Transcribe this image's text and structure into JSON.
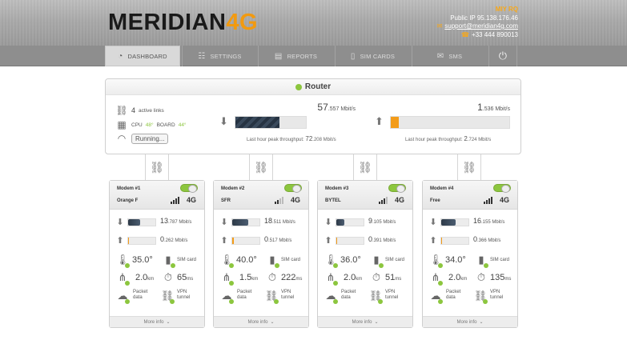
{
  "header": {
    "logo_part1": "MERIDIAN",
    "logo_part2": "4G",
    "site": "MIY RQ",
    "public_ip": "Public IP 95.138.176.46",
    "email": "support@meridian4g.com",
    "phone": "+33 444 890013",
    "email_icon": "mail-icon",
    "phone_icon": "phone-icon"
  },
  "nav": {
    "tabs": [
      {
        "label": "DASHBOARD",
        "icon": "gauge-icon",
        "active": true
      },
      {
        "label": "SETTINGS",
        "icon": "sliders-icon",
        "active": false
      },
      {
        "label": "REPORTS",
        "icon": "chart-icon",
        "active": false
      },
      {
        "label": "SIM CARDS",
        "icon": "simcard-icon",
        "active": false
      },
      {
        "label": "SMS",
        "icon": "envelope-icon",
        "active": false
      }
    ],
    "power_icon": "power-icon"
  },
  "router": {
    "title": "Router",
    "status_color": "#8cc63e",
    "links_count": "4",
    "links_label": "active links",
    "cpu_label": "CPU",
    "cpu_temp": "48°",
    "board_label": "BOARD",
    "board_temp": "44°",
    "running_label": "Running...",
    "download": {
      "value_int": "57",
      "value_dec": ".557 Mbit/s",
      "fill_percent": 62,
      "peak_label": "Last hour peak throughput:",
      "peak_int": "72",
      "peak_dec": ".208 Mbit/s"
    },
    "upload": {
      "value_int": "1",
      "value_dec": ".536 Mbit/s",
      "fill_percent": 7,
      "peak_label": "Last hour peak throughput:",
      "peak_int": "2",
      "peak_dec": ".724 Mbit/s"
    }
  },
  "modems": [
    {
      "name": "Modem #1",
      "operator": "Orange F",
      "network": "4G",
      "signal_bars": 4,
      "dl_int": "13",
      "dl_dec": ".787 Mbit/s",
      "dl_fill": 45,
      "ul_int": "0",
      "ul_dec": ".262 Mbit/s",
      "ul_fill": 3,
      "temp": "35.0°",
      "sim_label": "SIM card",
      "distance": "2.0",
      "distance_unit": "km",
      "latency": "65",
      "latency_unit": "ms",
      "packet_label1": "Packet",
      "packet_label2": "data",
      "vpn_label1": "VPN",
      "vpn_label2": "tunnel",
      "more_info": "More info"
    },
    {
      "name": "Modem #2",
      "operator": "SFR",
      "network": "4G",
      "signal_bars": 2,
      "dl_int": "18",
      "dl_dec": ".511 Mbit/s",
      "dl_fill": 58,
      "ul_int": "0",
      "ul_dec": ".517 Mbit/s",
      "ul_fill": 5,
      "temp": "40.0°",
      "sim_label": "SIM card",
      "distance": "1.5",
      "distance_unit": "km",
      "latency": "222",
      "latency_unit": "ms",
      "packet_label1": "Packet",
      "packet_label2": "data",
      "vpn_label1": "VPN",
      "vpn_label2": "tunnel",
      "more_info": "More info"
    },
    {
      "name": "Modem #3",
      "operator": "BYTEL",
      "network": "4G",
      "signal_bars": 3,
      "dl_int": "9",
      "dl_dec": ".105 Mbit/s",
      "dl_fill": 28,
      "ul_int": "0",
      "ul_dec": ".391 Mbit/s",
      "ul_fill": 4,
      "temp": "36.0°",
      "sim_label": "SIM card",
      "distance": "2.0",
      "distance_unit": "km",
      "latency": "51",
      "latency_unit": "ms",
      "packet_label1": "Packet",
      "packet_label2": "data",
      "vpn_label1": "VPN",
      "vpn_label2": "tunnel",
      "more_info": "More info"
    },
    {
      "name": "Modem #4",
      "operator": "Free",
      "network": "4G",
      "signal_bars": 4,
      "dl_int": "16",
      "dl_dec": ".155 Mbit/s",
      "dl_fill": 52,
      "ul_int": "0",
      "ul_dec": ".366 Mbit/s",
      "ul_fill": 4,
      "temp": "34.0°",
      "sim_label": "SIM card",
      "distance": "2.0",
      "distance_unit": "km",
      "latency": "135",
      "latency_unit": "ms",
      "packet_label1": "Packet",
      "packet_label2": "data",
      "vpn_label1": "VPN",
      "vpn_label2": "tunnel",
      "more_info": "More info"
    }
  ],
  "colors": {
    "accent": "#f29a10",
    "ok_green": "#8cc63e",
    "upload_orange": "#f39c1a"
  }
}
